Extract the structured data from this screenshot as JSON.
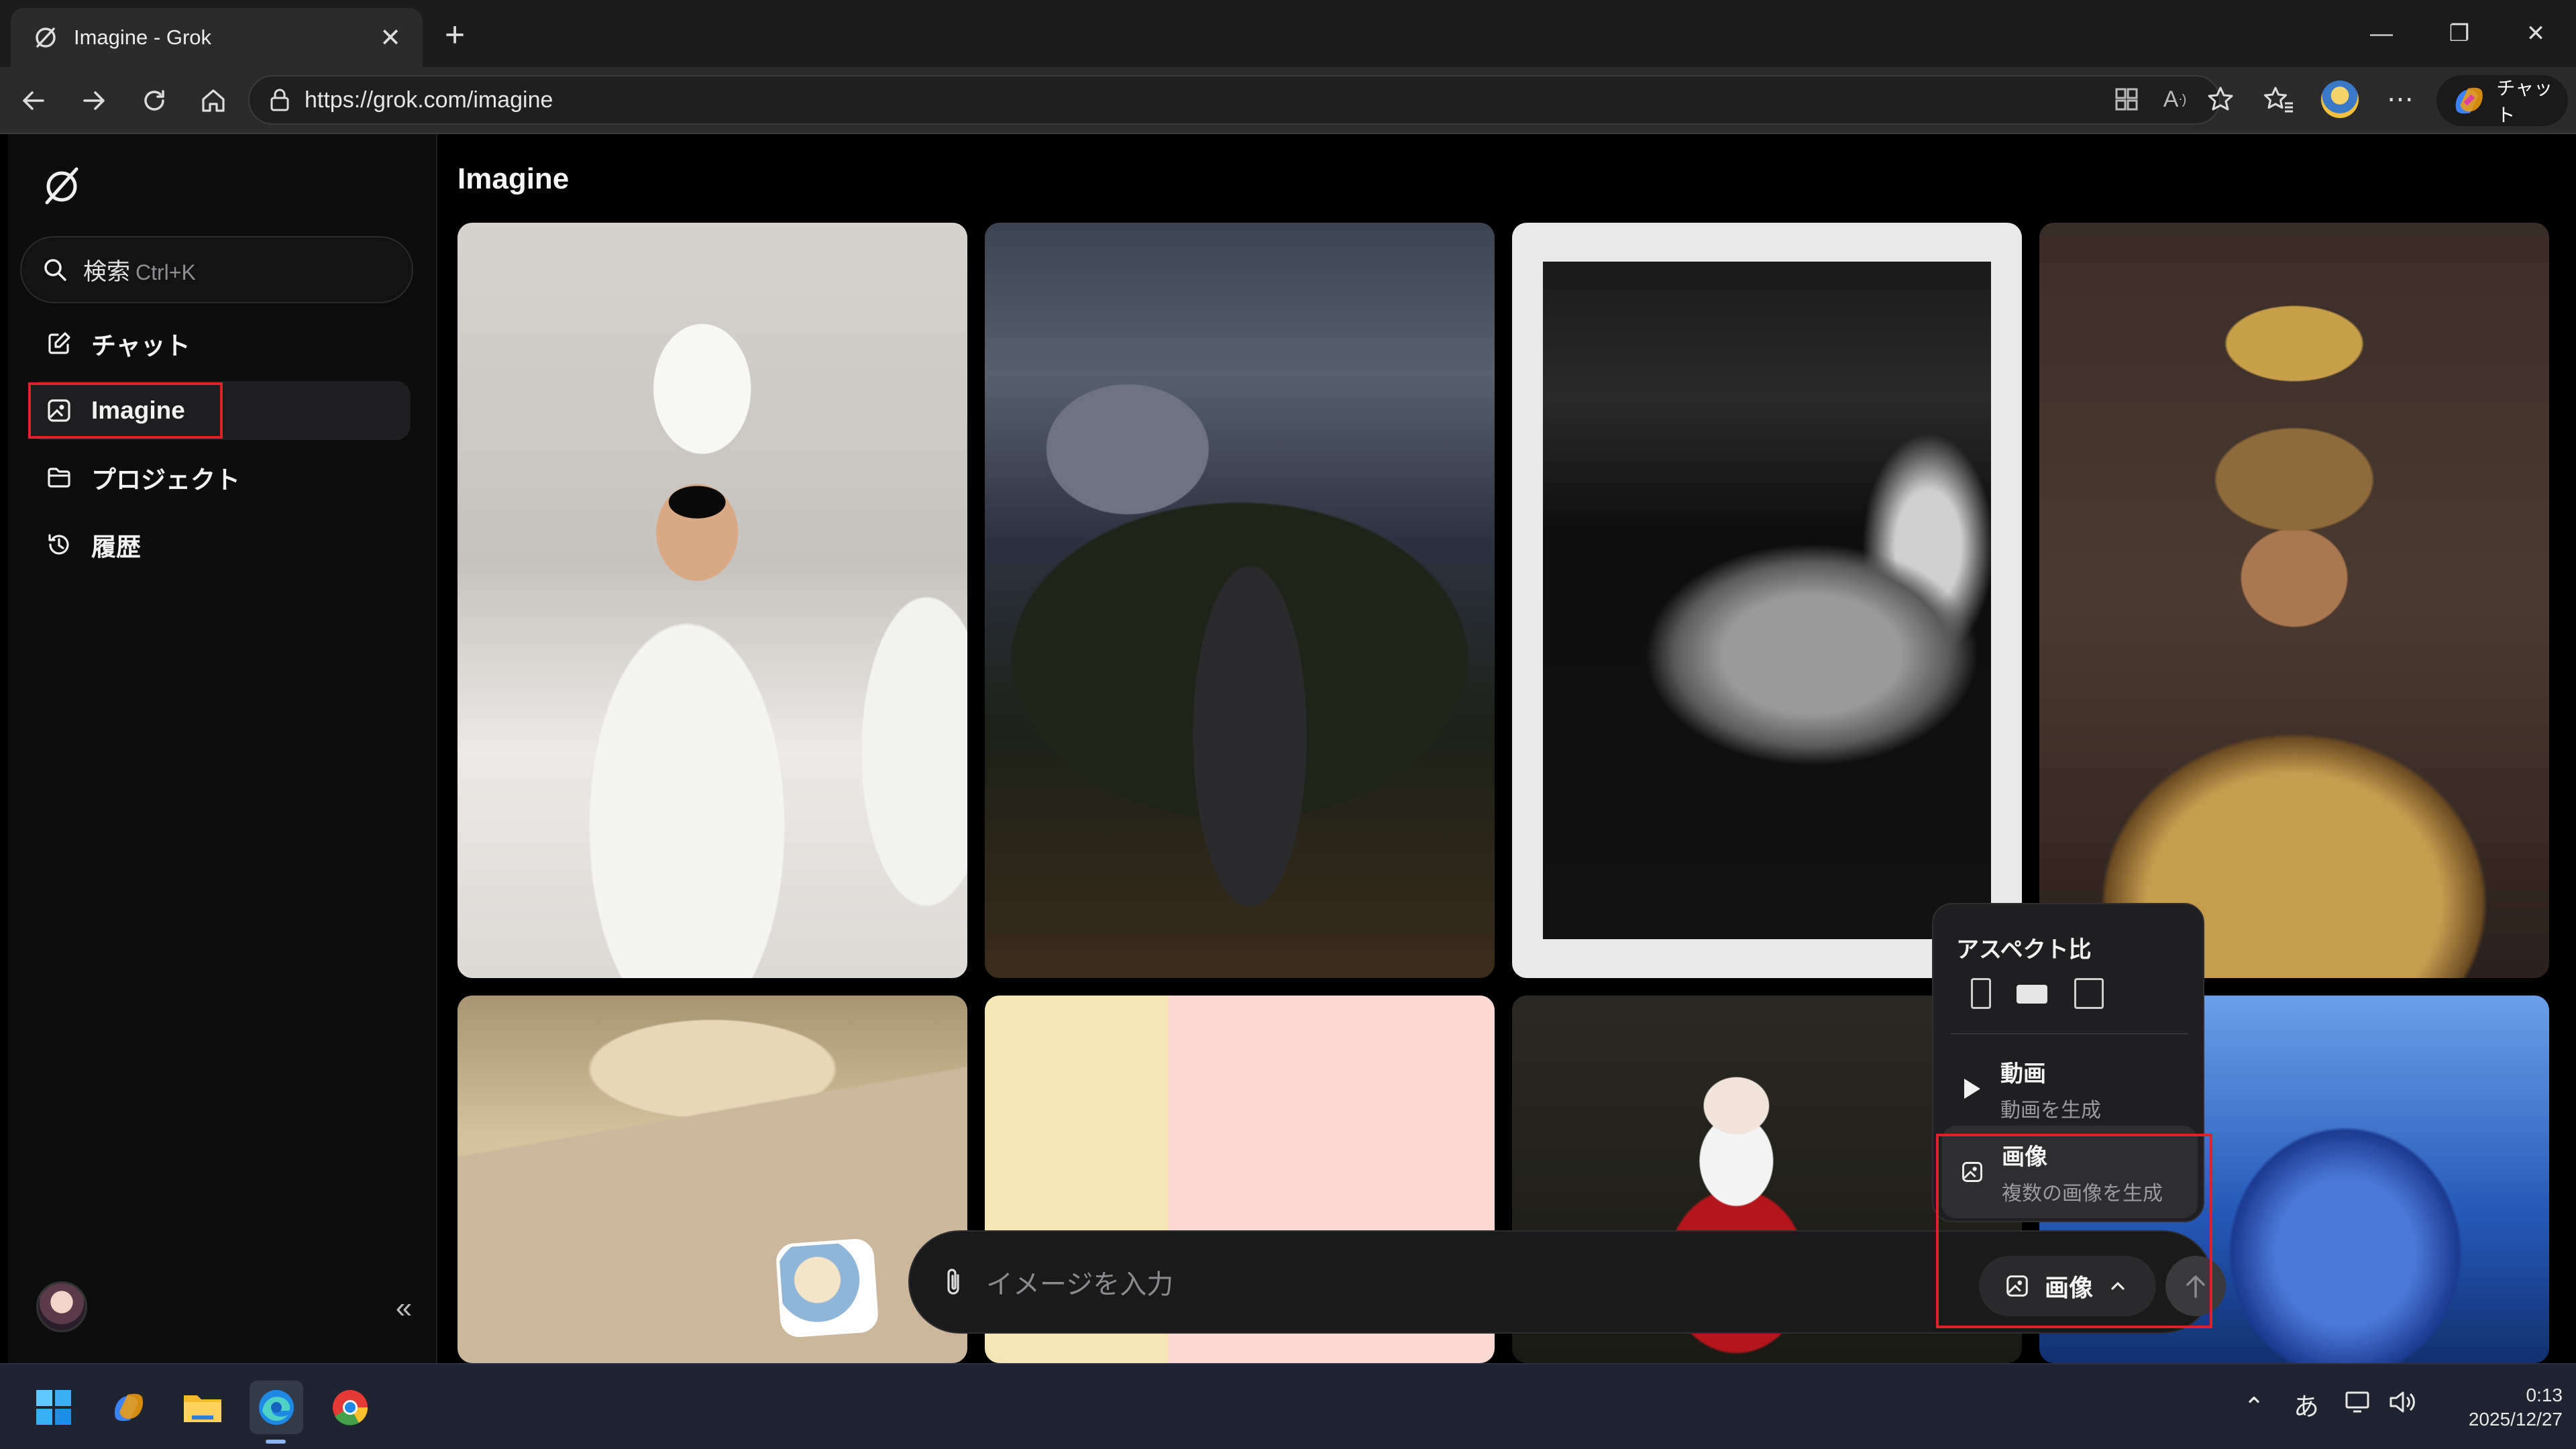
{
  "browser": {
    "tab_title": "Imagine - Grok",
    "url": "https://grok.com/imagine",
    "copilot_label": "チャット",
    "icons": [
      "back-icon",
      "forward-icon",
      "refresh-icon",
      "home-icon",
      "lock-icon",
      "apps-icon",
      "read-aloud-icon",
      "favorite-star-icon",
      "favorites-icon",
      "profile-icon",
      "more-icon"
    ]
  },
  "sidebar": {
    "search_placeholder": "検索",
    "search_shortcut": "Ctrl+K",
    "items": [
      {
        "label": "チャット",
        "icon": "edit-icon"
      },
      {
        "label": "Imagine",
        "icon": "image-icon",
        "active": true
      },
      {
        "label": "プロジェクト",
        "icon": "folder-icon"
      },
      {
        "label": "履歴",
        "icon": "history-icon"
      }
    ],
    "collapse_glyph": "«"
  },
  "main": {
    "title": "Imagine"
  },
  "composer": {
    "placeholder": "イメージを入力",
    "mode_label": "画像"
  },
  "popup": {
    "heading": "アスペクト比",
    "ratios": [
      "portrait",
      "landscape",
      "square"
    ],
    "selected_ratio": "landscape",
    "options": [
      {
        "title": "動画",
        "subtitle": "動画を生成",
        "icon": "play-icon"
      },
      {
        "title": "画像",
        "subtitle": "複数の画像を生成",
        "icon": "image-icon",
        "selected": true
      }
    ]
  },
  "taskbar": {
    "apps": [
      "windows-start-icon",
      "copilot-icon",
      "file-explorer-icon",
      "edge-icon",
      "chrome-icon"
    ],
    "ime": "あ",
    "time": "0:13",
    "date": "2025/12/27"
  },
  "colors": {
    "highlight": "#e0202a",
    "background": "#000000",
    "sidebar": "#0d0d0e"
  }
}
